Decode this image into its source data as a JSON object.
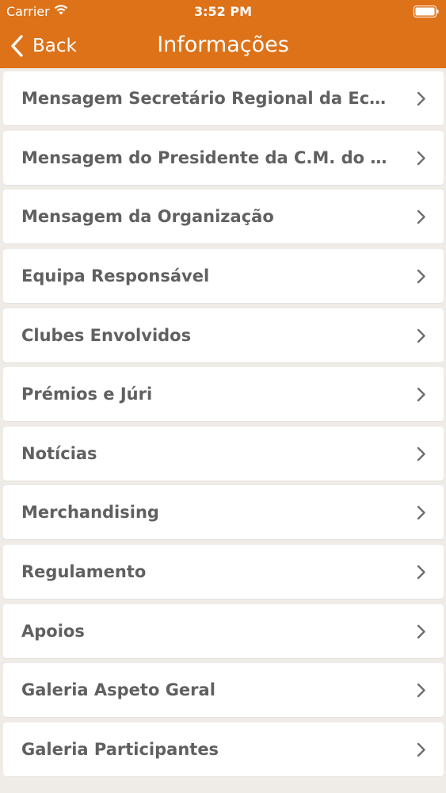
{
  "status_bar": {
    "carrier": "Carrier",
    "time": "3:52 PM",
    "icons": [
      "wifi-icon",
      "battery-icon"
    ]
  },
  "nav": {
    "back_label": "Back",
    "back_icon": "chevron-left-icon",
    "title": "Informações"
  },
  "list": {
    "items": [
      {
        "label": "Mensagem Secretário Regional da Eco…"
      },
      {
        "label": "Mensagem do Presidente da C.M. do F…"
      },
      {
        "label": "Mensagem da Organização"
      },
      {
        "label": "Equipa Responsável"
      },
      {
        "label": "Clubes Envolvidos"
      },
      {
        "label": "Prémios e Júri"
      },
      {
        "label": "Notícias"
      },
      {
        "label": "Merchandising"
      },
      {
        "label": "Regulamento"
      },
      {
        "label": "Apoios"
      },
      {
        "label": "Galeria Aspeto Geral"
      },
      {
        "label": "Galeria Participantes"
      }
    ],
    "item_icon": "chevron-right-icon"
  },
  "colors": {
    "header": "#dd7219",
    "background": "#efebe6",
    "item_text": "#606060",
    "chevron": "#6e6e6e"
  }
}
